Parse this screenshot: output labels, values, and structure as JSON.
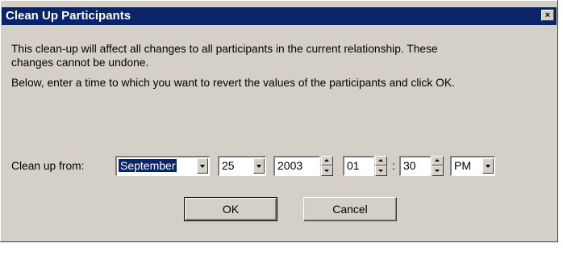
{
  "window": {
    "title": "Clean Up Participants",
    "close_glyph": "×"
  },
  "message": {
    "line1": "This clean-up will affect all changes to all participants in the current relationship.  These",
    "line2": "changes cannot be undone.",
    "line3": "Below, enter a time to which you want to revert the values of the participants and click OK."
  },
  "cleanup": {
    "label": "Clean up from:",
    "month": "September",
    "day": "25",
    "year": "2003",
    "hour": "01",
    "separator": ":",
    "minute": "30",
    "ampm": "PM"
  },
  "buttons": {
    "ok": "OK",
    "cancel": "Cancel"
  }
}
